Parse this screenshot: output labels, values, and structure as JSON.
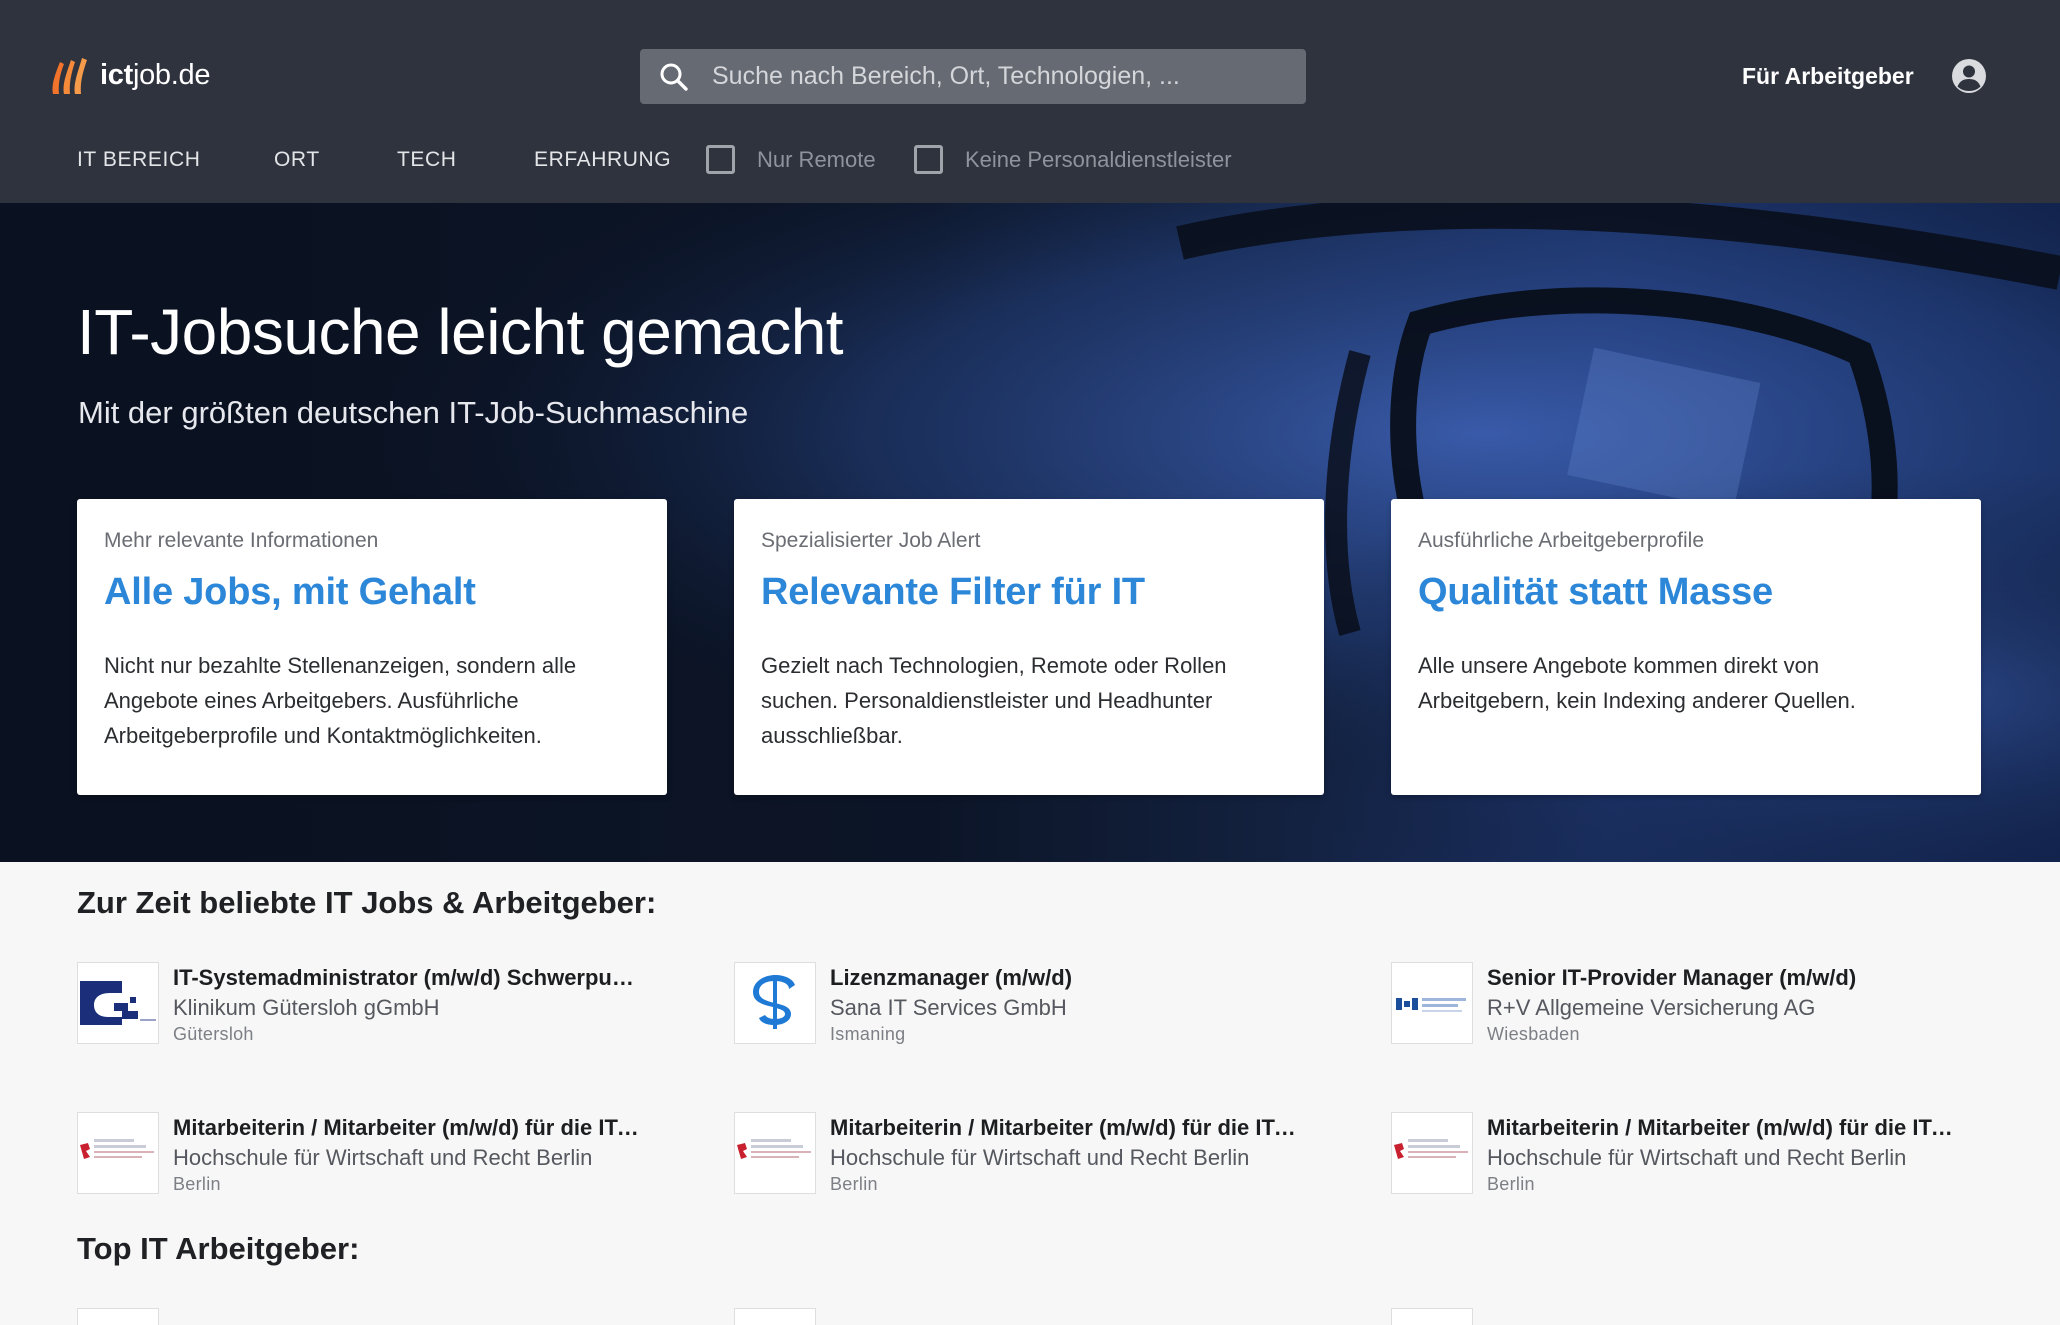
{
  "header": {
    "logo_text_bold": "ict",
    "logo_text_rest": "job.de",
    "search_placeholder": "Suche nach Bereich, Ort, Technologien, ...",
    "employer_link": "Für Arbeitgeber"
  },
  "filters": {
    "tabs": [
      "IT BEREICH",
      "ORT",
      "TECH",
      "ERFAHRUNG"
    ],
    "checkboxes": [
      {
        "label": "Nur Remote",
        "checked": false
      },
      {
        "label": "Keine Personaldienstleister",
        "checked": false
      }
    ]
  },
  "hero": {
    "title": "IT-Jobsuche leicht gemacht",
    "subtitle": "Mit der größten deutschen IT-Job-Suchmaschine",
    "cards": [
      {
        "kicker": "Mehr relevante Informationen",
        "title": "Alle Jobs, mit Gehalt",
        "text": "Nicht nur bezahlte Stellenanzeigen, sondern alle Angebote eines Arbeitgebers. Ausführliche Arbeitgeberprofile und Kontaktmöglichkeiten."
      },
      {
        "kicker": "Spezialisierter Job Alert",
        "title": "Relevante Filter für IT",
        "text": "Gezielt nach Technologien, Remote oder Rollen suchen. Personaldienstleister und Headhunter ausschließbar."
      },
      {
        "kicker": "Ausführliche Arbeitgeberprofile",
        "title": "Qualität statt Masse",
        "text": "Alle unsere Angebote kommen direkt von Arbeitgebern, kein Indexing anderer Quellen."
      }
    ]
  },
  "popular": {
    "heading": "Zur Zeit beliebte IT Jobs & Arbeitgeber:",
    "jobs": [
      {
        "title": "IT-Systemadministrator (m/w/d) Schwerpunkt Netzwerk",
        "company": "Klinikum Gütersloh gGmbH",
        "location": "Gütersloh",
        "logo": "klinikum-logo"
      },
      {
        "title": "Lizenzmanager (m/w/d)",
        "company": "Sana IT Services GmbH",
        "location": "Ismaning",
        "logo": "sana-logo"
      },
      {
        "title": "Senior IT-Provider Manager (m/w/d)",
        "company": "R+V Allgemeine Versicherung AG",
        "location": "Wiesbaden",
        "logo": "ruv-logo"
      },
      {
        "title": "Mitarbeiterin / Mitarbeiter (m/w/d) für die IT-Administration",
        "company": "Hochschule für Wirtschaft und Recht Berlin",
        "location": "Berlin",
        "logo": "hwr-logo"
      },
      {
        "title": "Mitarbeiterin / Mitarbeiter (m/w/d) für die IT-Administration",
        "company": "Hochschule für Wirtschaft und Recht Berlin",
        "location": "Berlin",
        "logo": "hwr-logo"
      },
      {
        "title": "Mitarbeiterin / Mitarbeiter (m/w/d) für die IT-Administration",
        "company": "Hochschule für Wirtschaft und Recht Berlin",
        "location": "Berlin",
        "logo": "hwr-logo"
      }
    ]
  },
  "top_employers": {
    "heading": "Top IT Arbeitgeber:"
  },
  "colors": {
    "header_bg": "#2f333d",
    "accent_blue": "#2c87d9",
    "logo_orange": "#f2732b"
  }
}
